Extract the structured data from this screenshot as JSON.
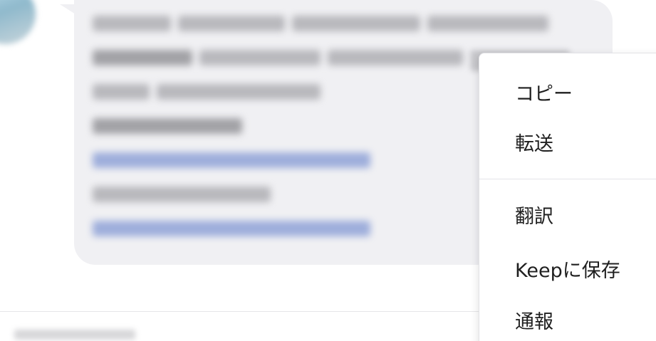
{
  "context_menu": {
    "items": [
      {
        "label": "コピー"
      },
      {
        "label": "転送"
      },
      {
        "label": "翻訳"
      },
      {
        "label": "Keepに保存"
      },
      {
        "label": "通報"
      }
    ]
  },
  "colors": {
    "bubble_background": "#f0f0f3",
    "menu_background": "#ffffff",
    "menu_text": "#1f1f1f",
    "divider": "#e4e4e8",
    "blurred_link": "#5b79c9"
  }
}
